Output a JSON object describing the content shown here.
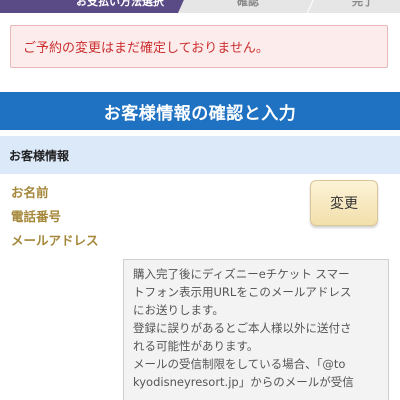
{
  "steps": {
    "current_label": "お支払い方法選択",
    "step2_label": "確認",
    "step3_label": "完了"
  },
  "notice": {
    "text": "ご予約の変更はまだ確定しておりません。"
  },
  "section": {
    "title": "お客様情報の確認と入力"
  },
  "customer_info": {
    "header": "お客様情報",
    "labels": {
      "name": "お名前",
      "phone": "電話番号",
      "email": "メールアドレス"
    },
    "change_button": "変更"
  },
  "info_box": {
    "lines": [
      "購入完了後にディズニーeチケット スマー",
      "トフォン表示用URLをこのメールアドレス",
      "にお送りします。",
      "登録に誤りがあるとご本人様以外に送付さ",
      "れる可能性があります。",
      "メールの受信制限をしている場合、「@to",
      "kyodisneyresort.jp」からのメールが受信"
    ]
  },
  "colors": {
    "primary_blue": "#1f71c2",
    "notice_red": "#cc2f2f",
    "label_gold": "#a5873a",
    "step_active": "#5a4a86"
  }
}
